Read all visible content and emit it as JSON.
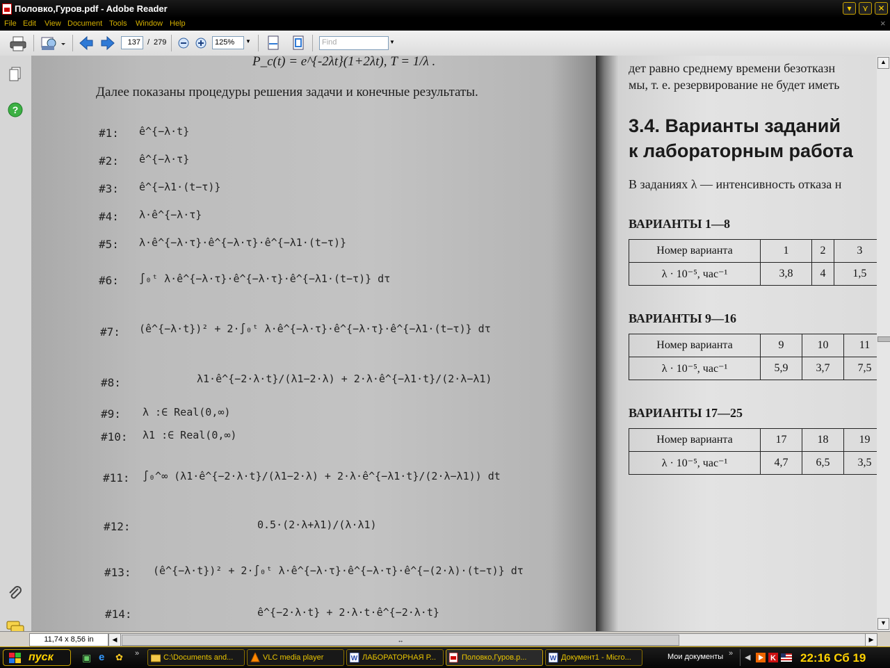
{
  "window": {
    "title": "Половко,Гуров.pdf - Adobe Reader"
  },
  "menu": [
    "File",
    "Edit",
    "View",
    "Document",
    "Tools",
    "Window",
    "Help"
  ],
  "toolbar": {
    "page_current": "137",
    "page_sep": "/",
    "page_total": "279",
    "zoom": "125%",
    "find_placeholder": "Find"
  },
  "left_page": {
    "header_formula": "P_c(t) = e^{-2λt}(1+2λt),   T = 1/λ .",
    "intro": "Далее показаны процедуры решения задачи и конечные результаты.",
    "equations": [
      {
        "label": "#1:",
        "expr": "ê^{−λ·t}"
      },
      {
        "label": "#2:",
        "expr": "ê^{−λ·τ}"
      },
      {
        "label": "#3:",
        "expr": "ê^{−λ1·(t−τ)}"
      },
      {
        "label": "#4:",
        "expr": "λ·ê^{−λ·τ}"
      },
      {
        "label": "#5:",
        "expr": "λ·ê^{−λ·τ}·ê^{−λ·τ}·ê^{−λ1·(t−τ)}"
      },
      {
        "label": "#6:",
        "expr": "∫₀ᵗ λ·ê^{−λ·τ}·ê^{−λ·τ}·ê^{−λ1·(t−τ)} dτ"
      },
      {
        "label": "#7:",
        "expr": "(ê^{−λ·t})² + 2·∫₀ᵗ λ·ê^{−λ·τ}·ê^{−λ·τ}·ê^{−λ1·(t−τ)} dτ"
      },
      {
        "label": "#8:",
        "expr": "λ1·ê^{−2·λ·t}/(λ1−2·λ) + 2·λ·ê^{−λ1·t}/(2·λ−λ1)"
      },
      {
        "label": "#9:",
        "expr": "λ :∈ Real(0,∞)"
      },
      {
        "label": "#10:",
        "expr": "λ1 :∈ Real(0,∞)"
      },
      {
        "label": "#11:",
        "expr": "∫₀^∞ (λ1·ê^{−2·λ·t}/(λ1−2·λ) + 2·λ·ê^{−λ1·t}/(2·λ−λ1)) dt"
      },
      {
        "label": "#12:",
        "expr": "0.5·(2·λ+λ1)/(λ·λ1)"
      },
      {
        "label": "#13:",
        "expr": "(ê^{−λ·t})² + 2·∫₀ᵗ λ·ê^{−λ·τ}·ê^{−λ·τ}·ê^{−(2·λ)·(t−τ)} dτ"
      },
      {
        "label": "#14:",
        "expr": "ê^{−2·λ·t} + 2·λ·t·ê^{−2·λ·t}"
      }
    ]
  },
  "right_page": {
    "line1": "дет равно среднему времени безотказн",
    "line2": "мы, т. е. резервирование не будет иметь",
    "heading1": "3.4. Варианты заданий",
    "heading2": "к лабораторным работа",
    "text": "В заданиях λ — интенсивность отказа н",
    "tables": [
      {
        "title": "ВАРИАНТЫ 1—8",
        "row1_label": "Номер варианта",
        "row2_label": "λ · 10⁻⁵, час⁻¹",
        "numbers": [
          "1",
          "2",
          "3"
        ],
        "values": [
          "3,8",
          "4",
          "1,5"
        ]
      },
      {
        "title": "ВАРИАНТЫ 9—16",
        "row1_label": "Номер варианта",
        "row2_label": "λ · 10⁻⁵, час⁻¹",
        "numbers": [
          "9",
          "10",
          "11"
        ],
        "values": [
          "5,9",
          "3,7",
          "7,5"
        ]
      },
      {
        "title": "ВАРИАНТЫ 17—25",
        "row1_label": "Номер варианта",
        "row2_label": "λ · 10⁻⁵, час⁻¹",
        "numbers": [
          "17",
          "18",
          "19"
        ],
        "values": [
          "4,7",
          "6,5",
          "3,5"
        ]
      }
    ]
  },
  "status": {
    "page_size": "11,74 x 8,56 in"
  },
  "taskbar": {
    "start": "пуск",
    "tasks": [
      "C:\\Documents and...",
      "VLC media player",
      "ЛАБОРАТОРНАЯ Р...",
      "Половко,Гуров.p...",
      "Документ1 - Micro..."
    ],
    "my_docs": "Мои документы",
    "clock": "22:16 Сб 19"
  },
  "colors": {
    "accent": "#ffd200",
    "menu_text": "#d4b000",
    "taskbar_bg": "#0a0a0a"
  }
}
